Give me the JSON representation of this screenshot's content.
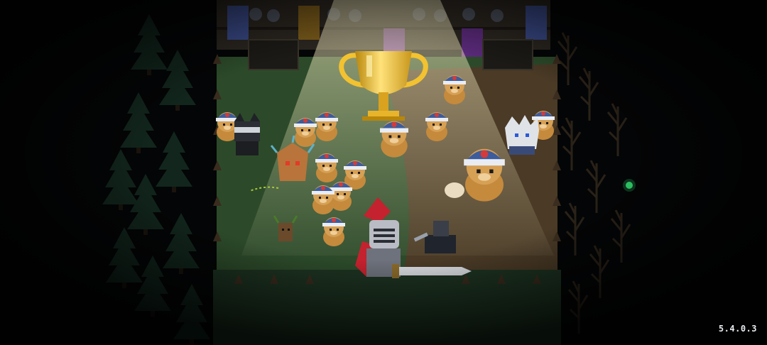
{
  "hud": {
    "version": "5.4.0.3"
  },
  "scene": {
    "setting": "forest-arena",
    "colors": {
      "grass": "#2c4a2a",
      "dirt": "#4a3a26",
      "trophy": "#f2c230",
      "spotlight": "#fff6c8",
      "knight_helmet": "#b9bcc4",
      "knight_plume": "#c4222e",
      "cap_blue": "#3c5c9c"
    },
    "icons": {
      "trophy": "trophy-icon",
      "knight": "knight-sprite",
      "indicator": "green-dot"
    }
  }
}
